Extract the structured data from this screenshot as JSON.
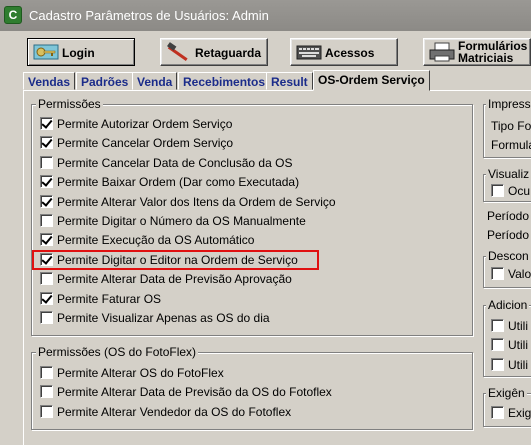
{
  "window": {
    "title": "Cadastro Parâmetros de Usuários: Admin",
    "icon_letter": "C"
  },
  "toolbar": {
    "login_label": "Login",
    "retaguarda_label": "Retaguarda",
    "acessos_label": "Acessos",
    "formularios_label_1": "Formulários",
    "formularios_label_2": "Matriciais"
  },
  "tabs": [
    "Vendas",
    "Padrões",
    "Venda",
    "Recebimentos",
    "Result",
    "OS-Ordem Serviço"
  ],
  "permissoes": {
    "title": "Permissões",
    "items": [
      {
        "label": "Permite Autorizar Ordem Serviço",
        "checked": true
      },
      {
        "label": "Permite Cancelar Ordem Serviço",
        "checked": true
      },
      {
        "label": "Permite Cancelar Data de Conclusão da OS",
        "checked": false
      },
      {
        "label": "Permite Baixar Ordem (Dar como Executada)",
        "checked": true
      },
      {
        "label": "Permite Alterar Valor dos Itens da Ordem de Serviço",
        "checked": true
      },
      {
        "label": "Permite Digitar o Número da OS Manualmente",
        "checked": false
      },
      {
        "label": "Permite Execução da OS Automático",
        "checked": true
      },
      {
        "label": "Permite Digitar o Editor na Ordem de Serviço",
        "checked": true
      },
      {
        "label": "Permite Alterar Data de Previsão Aprovação",
        "checked": false
      },
      {
        "label": "Permite Faturar OS",
        "checked": true
      },
      {
        "label": "Permite Visualizar Apenas as OS do dia",
        "checked": false
      }
    ]
  },
  "fotoflex": {
    "title": "Permissões (OS do FotoFlex)",
    "items": [
      {
        "label": "Permite Alterar OS do FotoFlex",
        "checked": false
      },
      {
        "label": "Permite Alterar Data de Previsão da OS do Fotoflex",
        "checked": false
      },
      {
        "label": "Permite Alterar Vendedor da OS do Fotoflex",
        "checked": false
      }
    ]
  },
  "right": {
    "impress_title": "Impress",
    "tipo_fo": "Tipo Fo",
    "formula": "Formula",
    "visualiz_title": "Visualiz",
    "ocu": "Ocu",
    "periodo1": "Período",
    "periodo2": "Período",
    "descon_title": "Descon",
    "valo": "Valo",
    "adicion_title": "Adicion",
    "utili1": "Utili",
    "utili2": "Utili",
    "utili3": "Utili",
    "exigen_title": "Exigên",
    "exig": "Exig"
  }
}
